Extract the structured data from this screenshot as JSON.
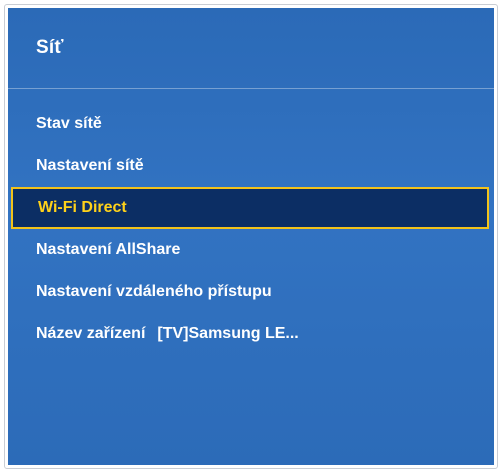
{
  "panel": {
    "title": "Síť"
  },
  "menu": {
    "items": [
      {
        "label": "Stav sítě"
      },
      {
        "label": "Nastavení sítě"
      },
      {
        "label": "Wi-Fi Direct"
      },
      {
        "label": "Nastavení AllShare"
      },
      {
        "label": "Nastavení vzdáleného přístupu"
      },
      {
        "label": "Název zařízení",
        "value": "[TV]Samsung LE..."
      }
    ],
    "selected_index": 2
  },
  "colors": {
    "panel_background": "#2f6fbd",
    "selected_background": "#0c2e64",
    "selected_border": "#f2c21a",
    "selected_text": "#ffd21a",
    "text": "#ffffff"
  }
}
